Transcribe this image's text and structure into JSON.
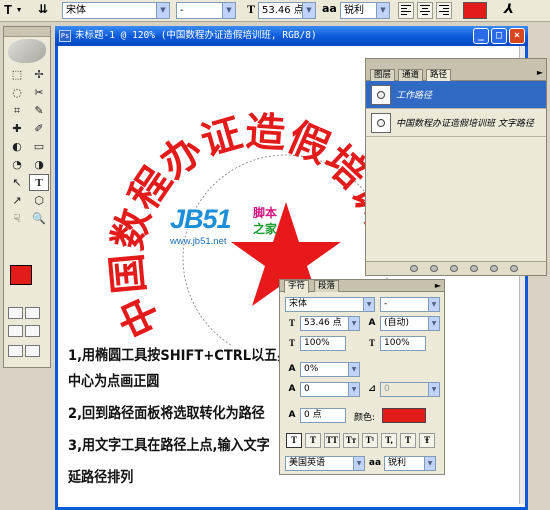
{
  "options_bar": {
    "tool_glyph": "T",
    "orientation_glyph": "⇊",
    "font_family": "宋体",
    "font_style": "-",
    "font_size": "53.46 点",
    "size_glyph": "T",
    "aa_glyph": "aa",
    "antialias": "锐利",
    "text_color": "#e31b1b",
    "warp_glyph": "⅄"
  },
  "document": {
    "title": "未标题-1 @ 120% (中国数程办证造假培训班, RGB/8)",
    "min_label": "_",
    "max_label": "□",
    "close_label": "×",
    "circle_text": "中国数程办证造假培训班",
    "star_color": "#e8191a",
    "text_color": "#e31b1b",
    "watermark": {
      "logo": "JB51",
      "line1": "脚本",
      "line2": "之家",
      "url": "www.jb51.net"
    },
    "instructions": [
      "1,用椭圆工具按SHIFT+CTRL以五星",
      "中心为点画正圆",
      "2,回到路径面板将选取转化为路径",
      "3,用文字工具在路径上点,输入文字",
      "延路径排列"
    ]
  },
  "paths_panel": {
    "tabs": [
      "图层",
      "通道",
      "路径"
    ],
    "menu_glyph": "►",
    "rows": [
      {
        "label": "工作路径",
        "active": true
      },
      {
        "label": "中国数程办证造假培训班 文字路径",
        "active": false
      }
    ]
  },
  "character_panel": {
    "tabs": [
      "字符",
      "段落"
    ],
    "menu_glyph": "►",
    "font_family": "宋体",
    "font_style": "-",
    "font_size": "53.46 点",
    "leading": "(自动)",
    "vertical_scale": "100%",
    "horizontal_scale": "100%",
    "kerning": "0%",
    "tracking": "0",
    "tracking_unit": "0",
    "baseline_shift": "0 点",
    "color_label": "颜色:",
    "color": "#e31b1b",
    "language": "美国英语",
    "antialias": "锐利",
    "style_buttons": [
      "T",
      "T",
      "TT",
      "Tт",
      "T¹",
      "T,",
      "T",
      "Ŧ"
    ]
  },
  "toolbox": {
    "tools": [
      "⬚",
      "✢",
      "◌",
      "✂",
      "⌗",
      "✎",
      "✚",
      "✐",
      "◐",
      "▭",
      "◔",
      "◑",
      "↖",
      "T",
      "↗",
      "⬡",
      "☟",
      "🔍"
    ]
  }
}
